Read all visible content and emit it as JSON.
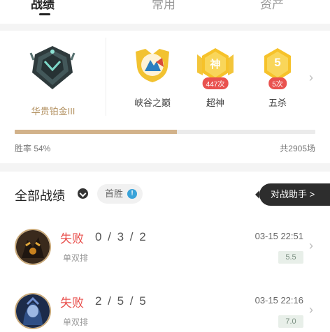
{
  "tabs": [
    {
      "label": "战绩",
      "active": true
    },
    {
      "label": "常用",
      "active": false
    },
    {
      "label": "资产",
      "active": false
    }
  ],
  "rank": {
    "name": "华贵铂金III",
    "emblem_icon": "platinum-rank-emblem-icon",
    "badges": [
      {
        "label": "峡谷之巅",
        "icon": "summit-icon",
        "count": ""
      },
      {
        "label": "超神",
        "icon": "legendary-badge-icon",
        "glyph": "神",
        "count": "447次"
      },
      {
        "label": "五杀",
        "icon": "pentakill-badge-icon",
        "glyph": "5",
        "count": "5次"
      }
    ],
    "win_rate_label": "胜率 54%",
    "win_rate": 0.54,
    "total_label": "共2905场"
  },
  "history": {
    "title": "全部战绩",
    "filter_chip": "首胜",
    "info_glyph": "!",
    "assist_button": "对战助手 >",
    "matches": [
      {
        "result": "失败",
        "kda": "0 / 3 / 2",
        "mode": "单双排",
        "time": "03-15 22:51",
        "score": "5.5"
      },
      {
        "result": "失败",
        "kda": "2 / 5 / 5",
        "mode": "单双排",
        "time": "03-15 22:16",
        "score": "7.0"
      }
    ]
  },
  "colors": {
    "accent_gold": "#d2b28a",
    "loss_red": "#e9524f",
    "dark_button": "#2d2d2d"
  }
}
